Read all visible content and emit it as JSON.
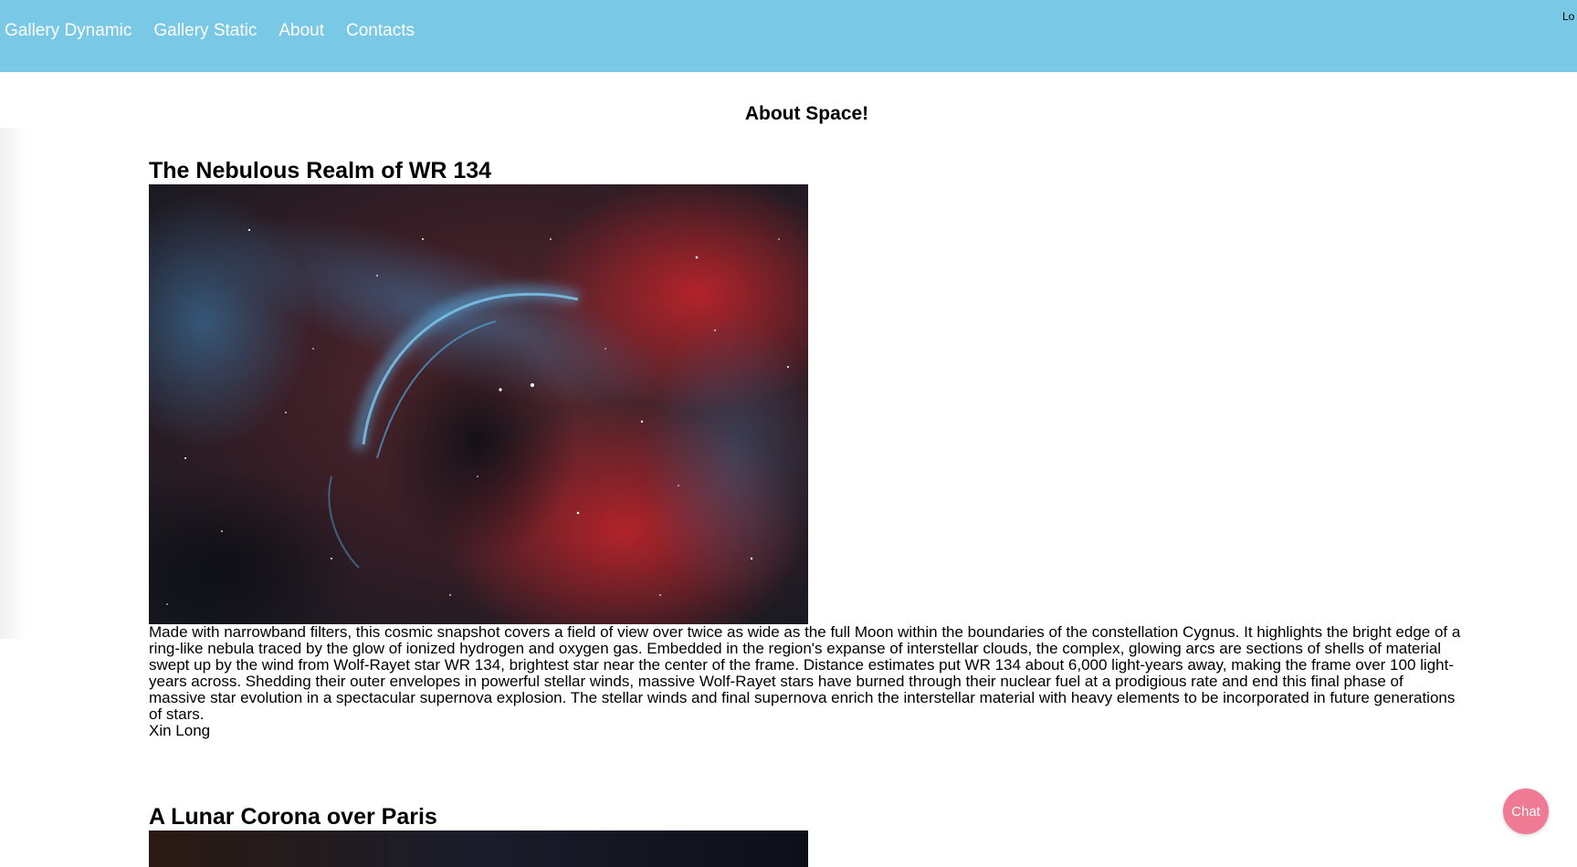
{
  "nav": {
    "items": [
      {
        "label": "Gallery Dynamic"
      },
      {
        "label": "Gallery Static"
      },
      {
        "label": "About"
      },
      {
        "label": "Contacts"
      }
    ],
    "login_label": "Lo"
  },
  "page": {
    "title": "About Space!"
  },
  "articles": [
    {
      "title": "The Nebulous Realm of WR 134",
      "image_alt": "Nebula WR 134 in narrowband: blue arc over red hydrogen clouds and stars",
      "description": "Made with narrowband filters, this cosmic snapshot covers a field of view over twice as wide as the full Moon within the boundaries of the constellation Cygnus. It highlights the bright edge of a ring-like nebula traced by the glow of ionized hydrogen and oxygen gas. Embedded in the region's expanse of interstellar clouds, the complex, glowing arcs are sections of shells of material swept up by the wind from Wolf-Rayet star WR 134, brightest star near the center of the frame. Distance estimates put WR 134 about 6,000 light-years away, making the frame over 100 light-years across. Shedding their outer envelopes in powerful stellar winds, massive Wolf-Rayet stars have burned through their nuclear fuel at a prodigious rate and end this final phase of massive star evolution in a spectacular supernova explosion. The stellar winds and final supernova enrich the interstellar material with heavy elements to be incorporated in future generations of stars.",
      "author": "Xin Long"
    },
    {
      "title": "A Lunar Corona over Paris"
    }
  ],
  "chat": {
    "label": "Chat"
  },
  "colors": {
    "topbar": "#78c8e6",
    "chat_button": "#ee7a93"
  }
}
